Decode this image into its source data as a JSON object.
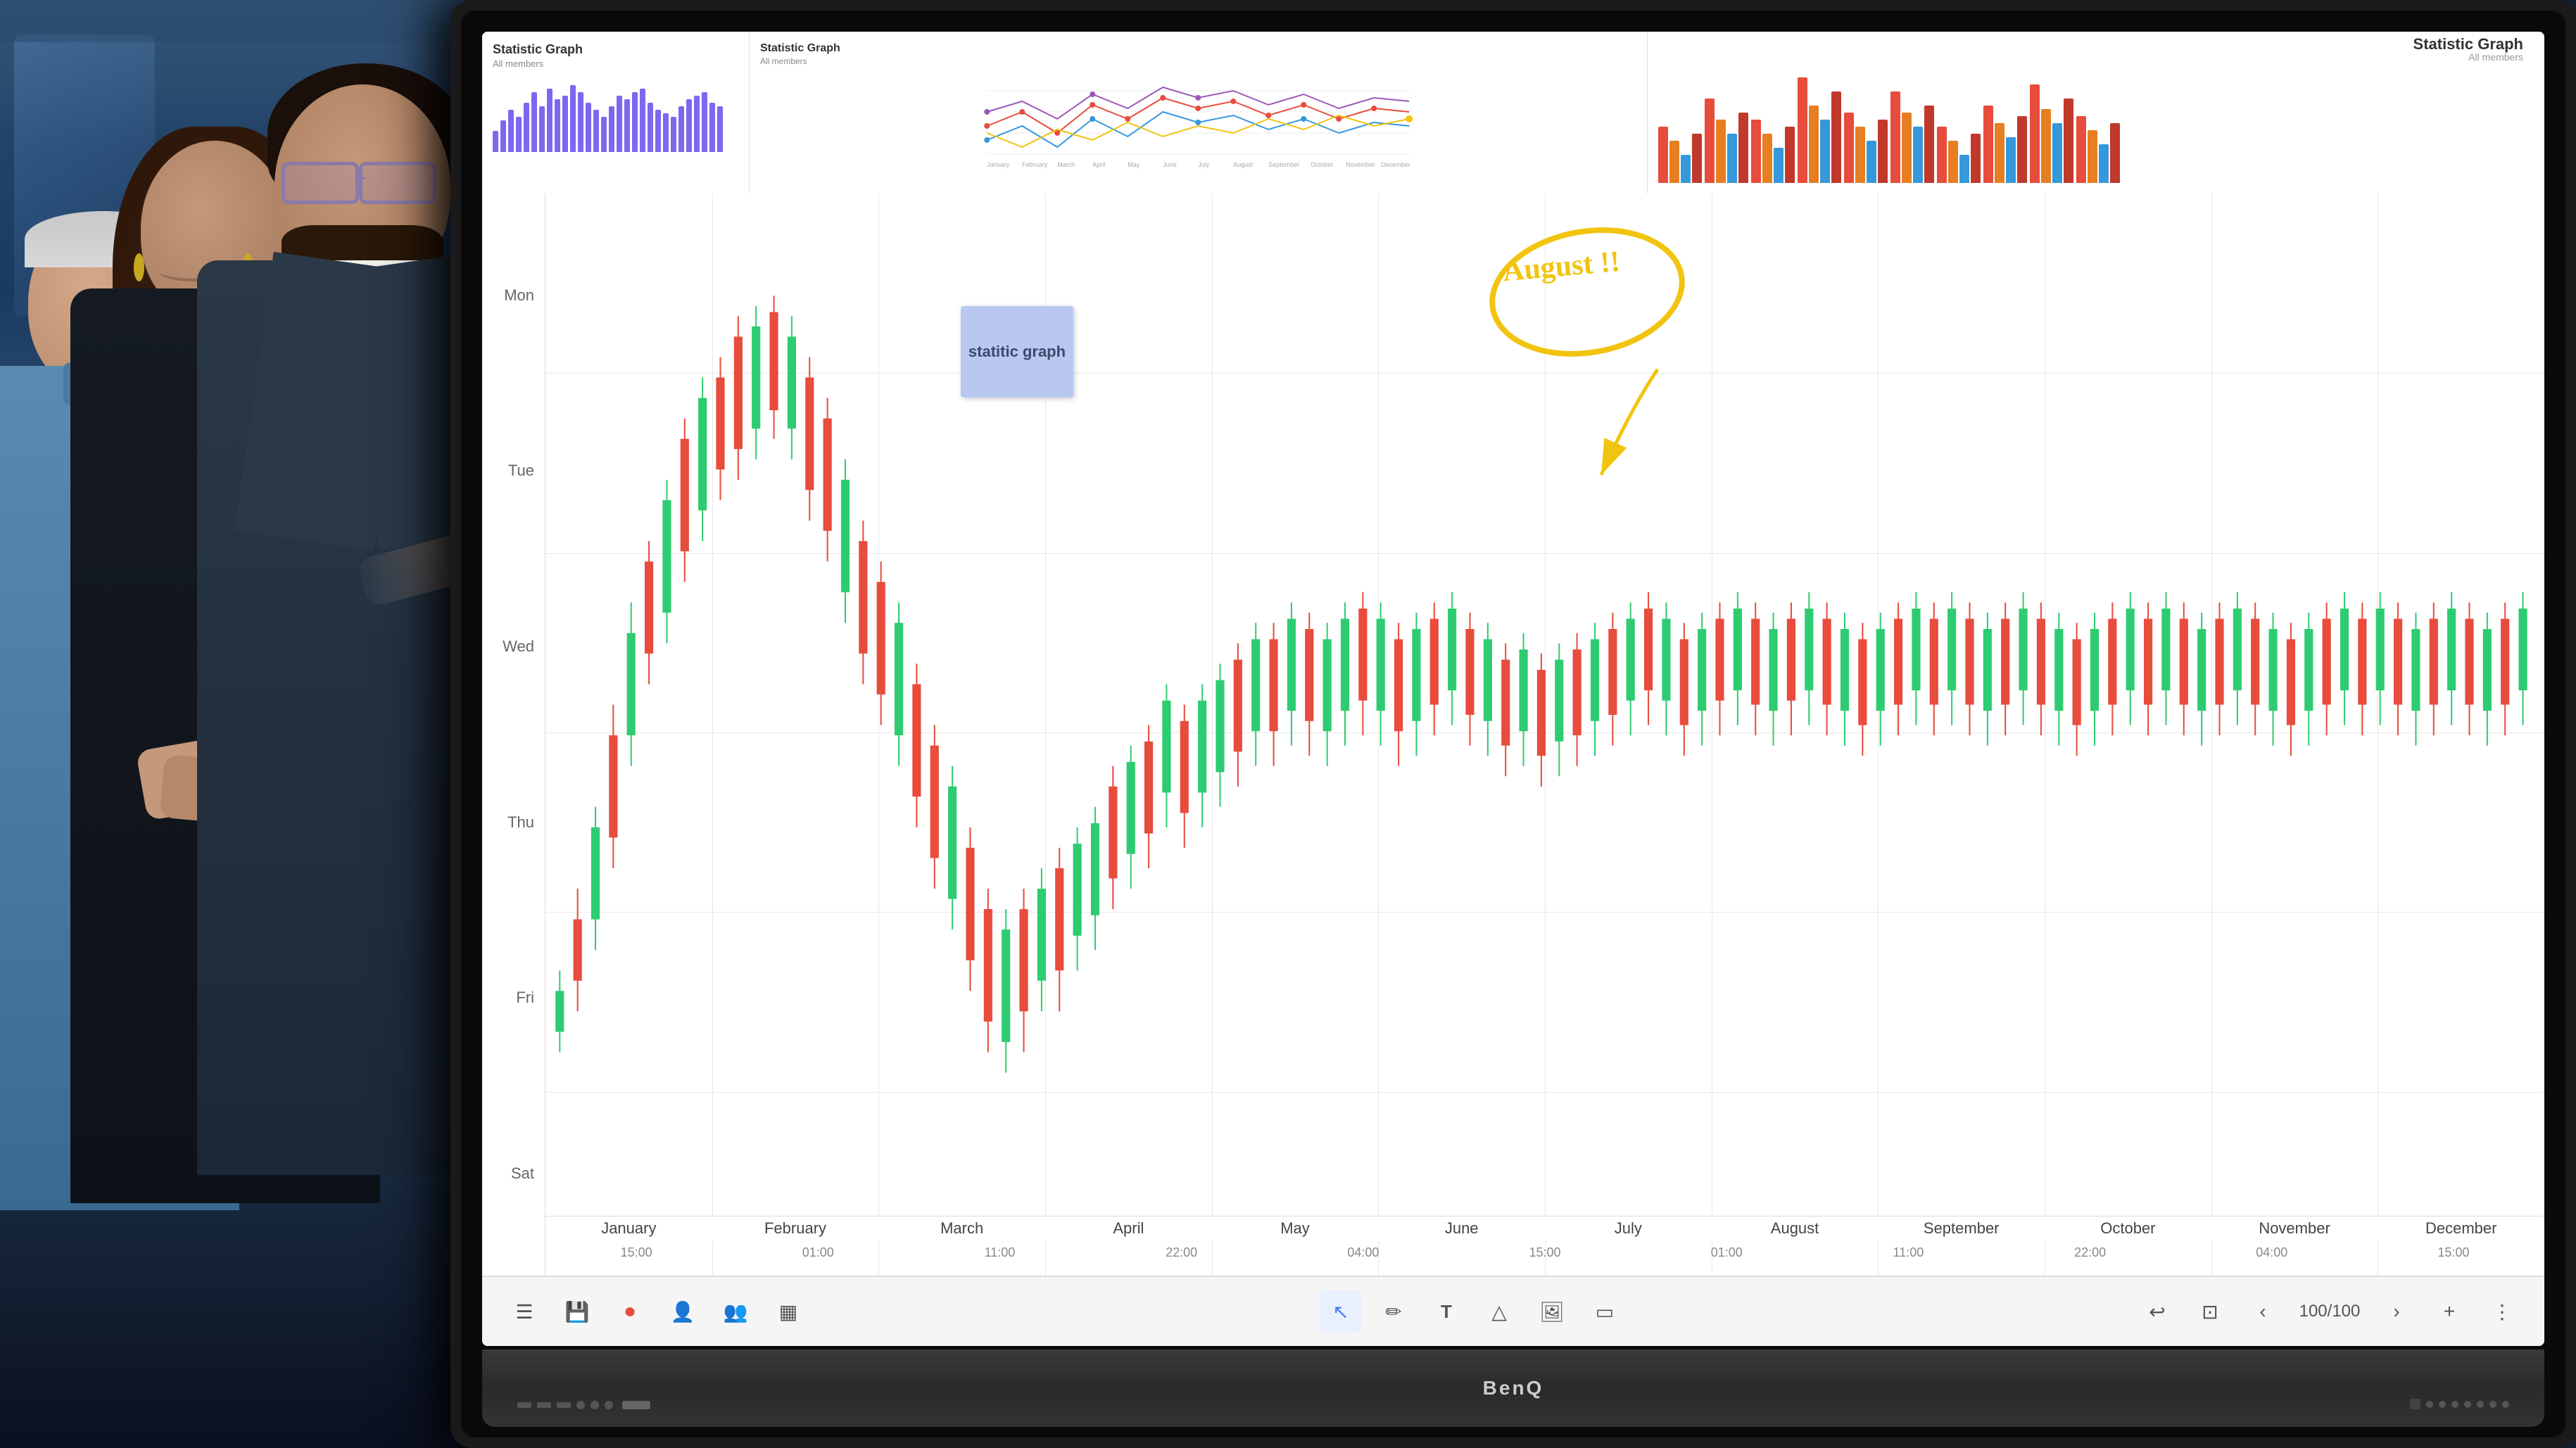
{
  "scene": {
    "bg_color": "#1a2a3a"
  },
  "display": {
    "brand": "BenQ",
    "screen_bg": "#ffffff"
  },
  "charts": {
    "top_left": {
      "title": "Statistic Graph",
      "subtitle": "All members",
      "bar_heights": [
        30,
        45,
        60,
        50,
        70,
        85,
        65,
        90,
        75,
        80,
        95,
        85,
        70,
        60,
        50,
        65,
        80,
        75,
        85,
        90,
        70,
        60,
        55,
        50,
        65,
        75,
        80,
        85,
        70,
        65
      ]
    },
    "top_middle": {
      "title": "Statistic Graph",
      "subtitle": "All members",
      "lines": [
        "#e74c3c",
        "#3498db",
        "#9b59b6",
        "#2ecc71"
      ],
      "x_labels": [
        "January",
        "February",
        "March",
        "April",
        "May",
        "June",
        "July",
        "August",
        "September",
        "October",
        "November",
        "December"
      ]
    },
    "top_right": {
      "bar_groups": [
        {
          "red": 80,
          "orange": 60,
          "blue": 40,
          "darkred": 70
        },
        {
          "red": 120,
          "orange": 90,
          "blue": 70,
          "darkred": 100
        },
        {
          "red": 90,
          "orange": 70,
          "blue": 50,
          "darkred": 80
        },
        {
          "red": 150,
          "orange": 110,
          "blue": 90,
          "darkred": 130
        },
        {
          "red": 100,
          "orange": 80,
          "blue": 60,
          "darkred": 90
        },
        {
          "red": 130,
          "orange": 100,
          "blue": 80,
          "darkred": 110
        },
        {
          "red": 80,
          "orange": 60,
          "blue": 40,
          "darkred": 70
        },
        {
          "red": 110,
          "orange": 85,
          "blue": 65,
          "darkred": 95
        },
        {
          "red": 140,
          "orange": 105,
          "blue": 85,
          "darkred": 120
        },
        {
          "red": 95,
          "orange": 75,
          "blue": 55,
          "darkred": 85
        }
      ]
    },
    "main": {
      "y_labels": [
        "Mon",
        "Tue",
        "Wed",
        "Thu",
        "Fri",
        "Sat"
      ],
      "x_months": [
        "January",
        "February",
        "March",
        "April",
        "May",
        "June",
        "July",
        "August",
        "September",
        "October",
        "November",
        "December"
      ],
      "x_times": [
        "15:00",
        "01:00",
        "11:00",
        "22:00",
        "04:00",
        "15:00",
        "01:00",
        "11:00",
        "22:00",
        "04:00",
        "15:00"
      ],
      "annotation_note": "statitic\ngraph",
      "annotation_august": "August !!"
    }
  },
  "toolbar": {
    "menu_icon": "☰",
    "save_icon": "💾",
    "record_icon": "⏺",
    "user_icon": "👤",
    "users_icon": "👥",
    "grid_icon": "▦",
    "cursor_icon": "↖",
    "pen_icon": "✏",
    "text_icon": "T",
    "shape_icon": "△",
    "image_icon": "🖼",
    "eraser_icon": "▭",
    "undo_icon": "↩",
    "screen_icon": "⊡",
    "prev_icon": "‹",
    "page_count": "100/100",
    "next_icon": "›",
    "zoom_icon": "+",
    "more_icon": "⋮"
  }
}
